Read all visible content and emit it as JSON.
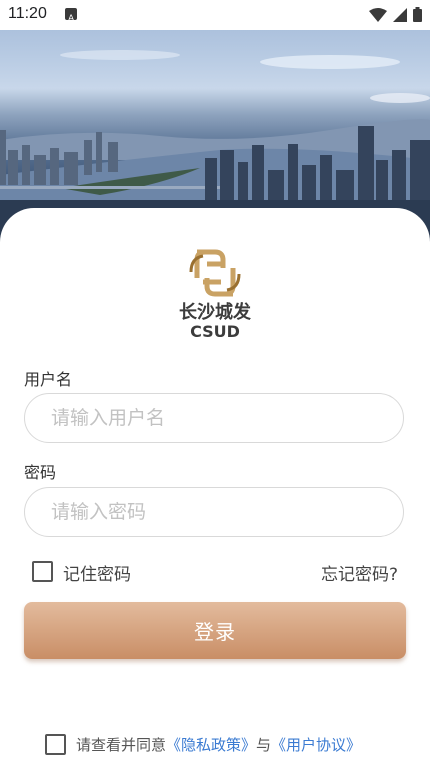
{
  "status_bar": {
    "time": "11:20",
    "icons": [
      "notification-a-icon",
      "wifi-icon",
      "cell-signal-icon",
      "battery-icon"
    ]
  },
  "brand": {
    "name_cn": "长沙城发",
    "name_en": "CSUD",
    "logo": "csud-logo"
  },
  "form": {
    "username_label": "用户名",
    "username_placeholder": "请输入用户名",
    "password_label": "密码",
    "password_placeholder": "请输入密码",
    "remember_label": "记住密码",
    "forgot_label": "忘记密码?",
    "login_label": "登录"
  },
  "agreement": {
    "prefix": "请查看并同意",
    "privacy_link": "《隐私政策》",
    "connector": "与",
    "user_link": "《用户协议》"
  },
  "colors": {
    "accent_top": "#e3bb9d",
    "accent_bottom": "#c98e66",
    "link": "#3b7bd2"
  }
}
